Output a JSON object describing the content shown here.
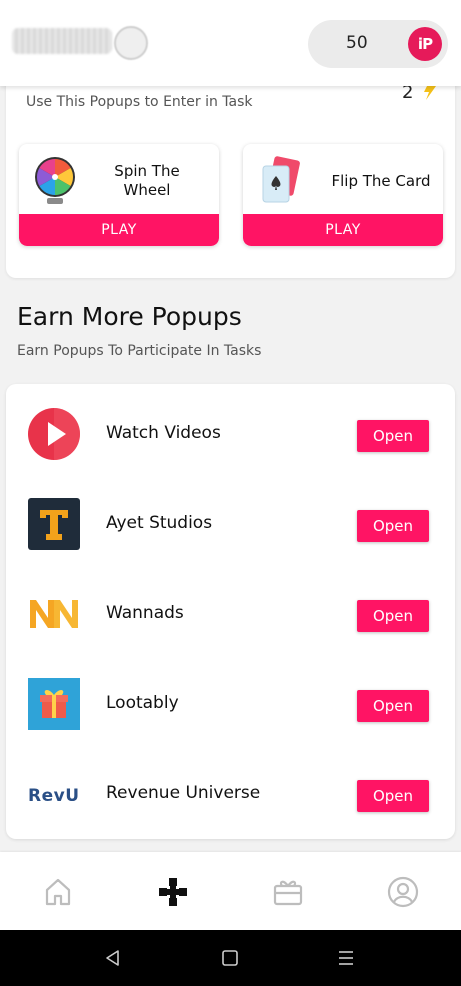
{
  "header": {
    "coins": "50",
    "logo_text": "iP"
  },
  "task_card": {
    "subtitle": "Use This Popups to Enter in Task",
    "games": [
      {
        "title_line1": "Spin The",
        "title_line2": "Wheel",
        "button": "PLAY"
      },
      {
        "title": "Flip The Card",
        "button": "PLAY"
      }
    ]
  },
  "earn_section": {
    "title": "Earn More Popups",
    "subtitle": "Earn Popups To Participate In Tasks"
  },
  "offers": [
    {
      "name": "Watch Videos",
      "button": "Open",
      "icon": "play-icon"
    },
    {
      "name": "Ayet Studios",
      "button": "Open",
      "icon": "ayet-logo-icon"
    },
    {
      "name": "Wannads",
      "button": "Open",
      "icon": "wannads-logo-icon"
    },
    {
      "name": "Lootably",
      "button": "Open",
      "icon": "gift-icon"
    },
    {
      "name": "Revenue Universe",
      "button": "Open",
      "icon": "revu-logo-icon",
      "icon_text": "RevU"
    }
  ],
  "bottom_nav": [
    "home-icon",
    "gamepad-icon",
    "gift-box-icon",
    "profile-icon"
  ],
  "colors": {
    "accent": "#ff1464",
    "brand": "#e61a5a"
  }
}
